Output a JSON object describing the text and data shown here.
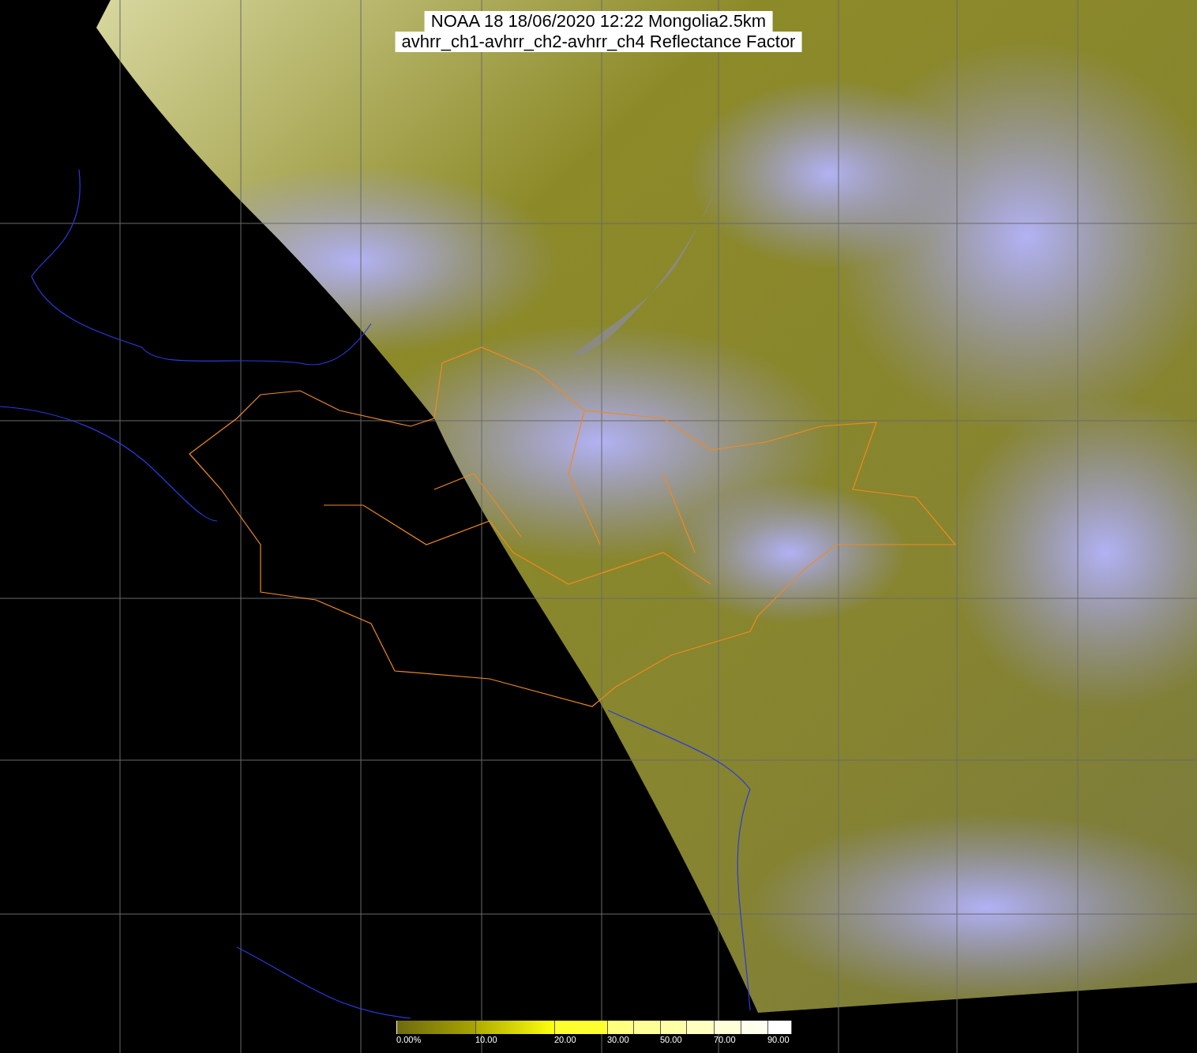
{
  "title": {
    "lines": [
      "NOAA 18 18/06/2020 12:22 Mongolia2.5km",
      "avhrr_ch1-avhrr_ch2-avhrr_ch4 Reflectance Factor"
    ]
  },
  "colorbar": {
    "labels": [
      "0.00%",
      "10.00",
      "20.00",
      "30.00",
      "50.00",
      "70.00",
      "90.00"
    ]
  }
}
